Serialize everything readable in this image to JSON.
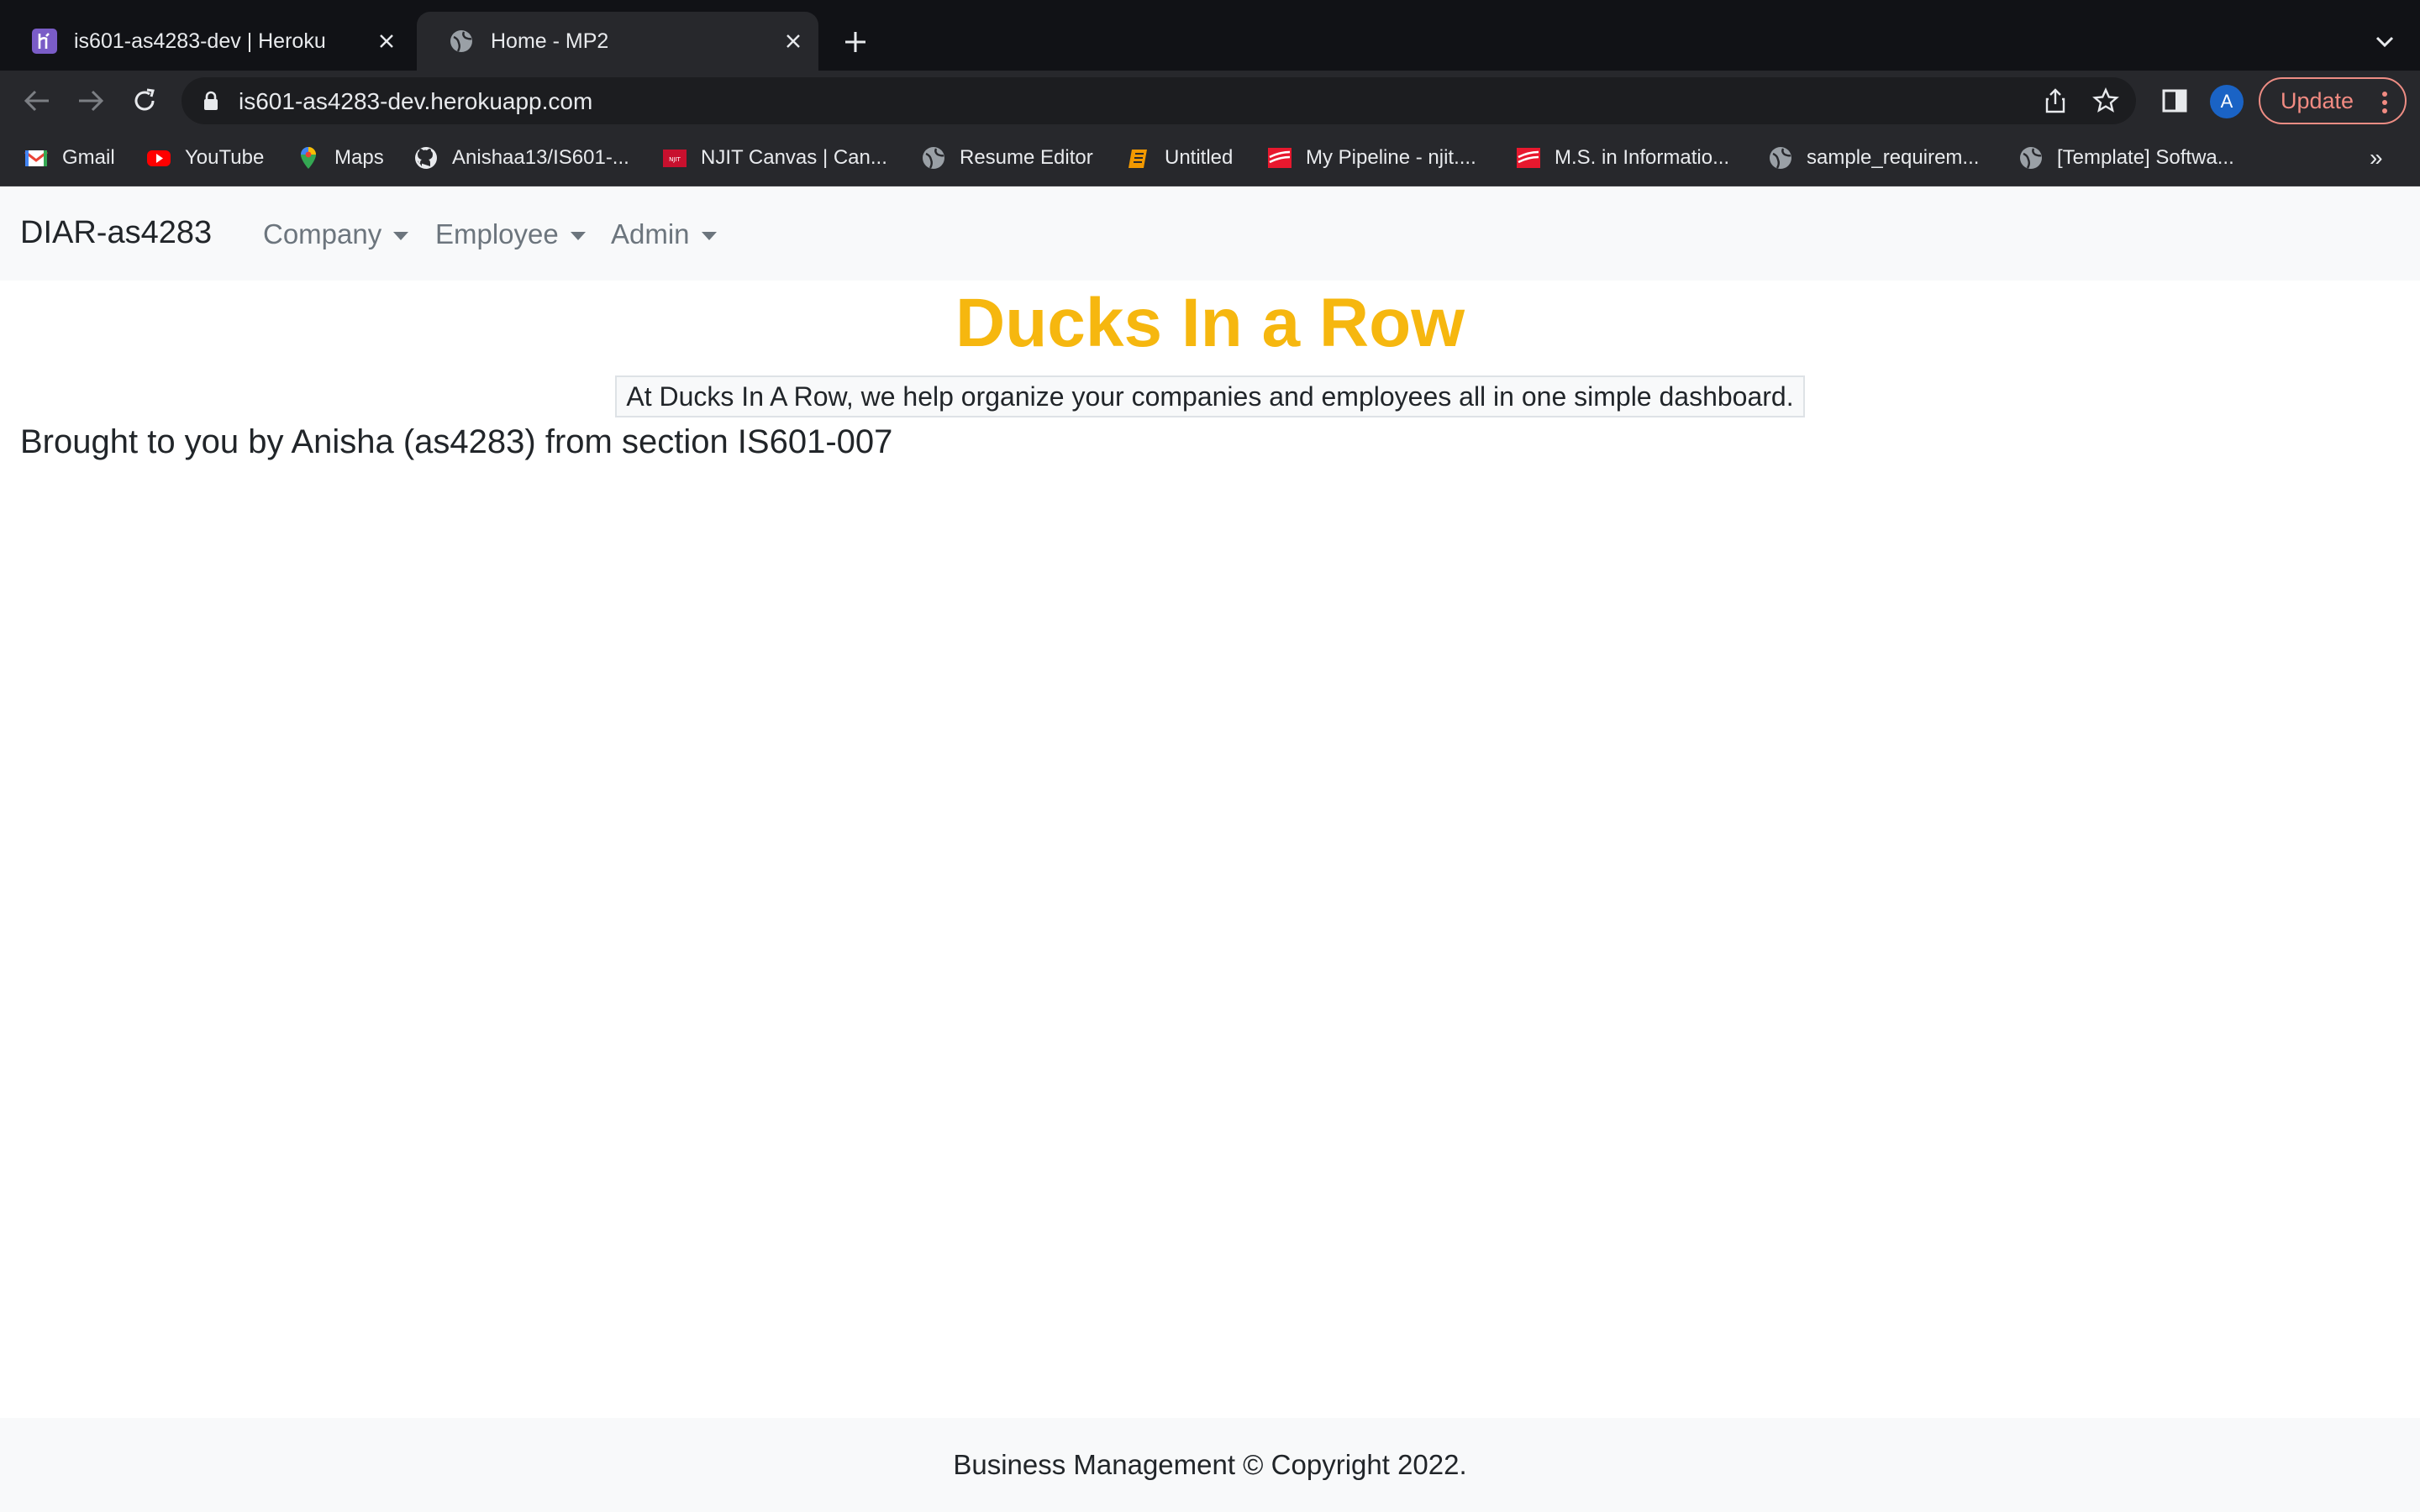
{
  "browser": {
    "tabs": [
      {
        "title": "is601-as4283-dev | Heroku",
        "icon": "heroku-icon",
        "active": false
      },
      {
        "title": "Home - MP2",
        "icon": "globe-icon",
        "active": true
      }
    ],
    "url": "is601-as4283-dev.herokuapp.com",
    "profile_initial": "A",
    "update_label": "Update",
    "bookmarks": [
      {
        "label": "Gmail",
        "icon": "gmail-icon"
      },
      {
        "label": "YouTube",
        "icon": "youtube-icon"
      },
      {
        "label": "Maps",
        "icon": "maps-icon"
      },
      {
        "label": "Anishaa13/IS601-...",
        "icon": "github-icon"
      },
      {
        "label": "NJIT Canvas | Can...",
        "icon": "njit-icon"
      },
      {
        "label": "Resume Editor",
        "icon": "globe-icon"
      },
      {
        "label": "Untitled",
        "icon": "notebook-icon"
      },
      {
        "label": "My Pipeline - njit....",
        "icon": "handshake-icon"
      },
      {
        "label": "M.S. in Informatio...",
        "icon": "handshake-icon"
      },
      {
        "label": "sample_requirem...",
        "icon": "globe-icon"
      },
      {
        "label": "[Template] Softwa...",
        "icon": "globe-icon"
      }
    ],
    "bookmarks_overflow": "»",
    "colors": {
      "update_accent": "#f28b82",
      "avatar": "#1a63c5"
    }
  },
  "site": {
    "brand": "DIAR-as4283",
    "nav": [
      {
        "label": "Company"
      },
      {
        "label": "Employee"
      },
      {
        "label": "Admin"
      }
    ],
    "hero_title": "Ducks In a Row",
    "hero_tagline": "At Ducks In A Row, we help organize your companies and employees all in one simple dashboard.",
    "credit": "Brought to you by Anisha (as4283) from section IS601-007",
    "footer": "Business Management © Copyright 2022.",
    "colors": {
      "hero_title": "#f6b70f"
    }
  }
}
